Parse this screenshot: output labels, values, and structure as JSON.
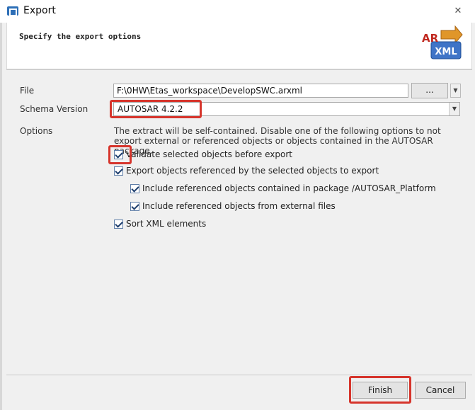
{
  "window": {
    "title": "Export",
    "close": "✕"
  },
  "banner": {
    "text": "Specify the export options",
    "logo_text_top": "AR",
    "logo_text_bottom": "XML"
  },
  "form": {
    "file_label": "File",
    "file_value": "F:\\0HW\\Etas_workspace\\DevelopSWC.arxml",
    "browse_label": "...",
    "schema_label": "Schema Version",
    "schema_value": "AUTOSAR 4.2.2",
    "options_label": "Options",
    "options_desc": "The extract will be self-contained. Disable one of the following options to not export external or referenced objects or objects contained in the AUTOSAR package.",
    "checkboxes": [
      {
        "label": "Validate selected objects before export",
        "checked": true
      },
      {
        "label": "Export objects referenced by the selected objects to export",
        "checked": true
      },
      {
        "label": "Include referenced objects contained in package /AUTOSAR_Platform",
        "checked": true
      },
      {
        "label": "Include referenced objects from external files",
        "checked": true
      },
      {
        "label": "Sort XML elements",
        "checked": true
      }
    ]
  },
  "buttons": {
    "finish": "Finish",
    "cancel": "Cancel"
  },
  "colors": {
    "highlight": "#d6352c",
    "title_bar": "#ffffff",
    "dialog_bg": "#f0f0f0"
  }
}
